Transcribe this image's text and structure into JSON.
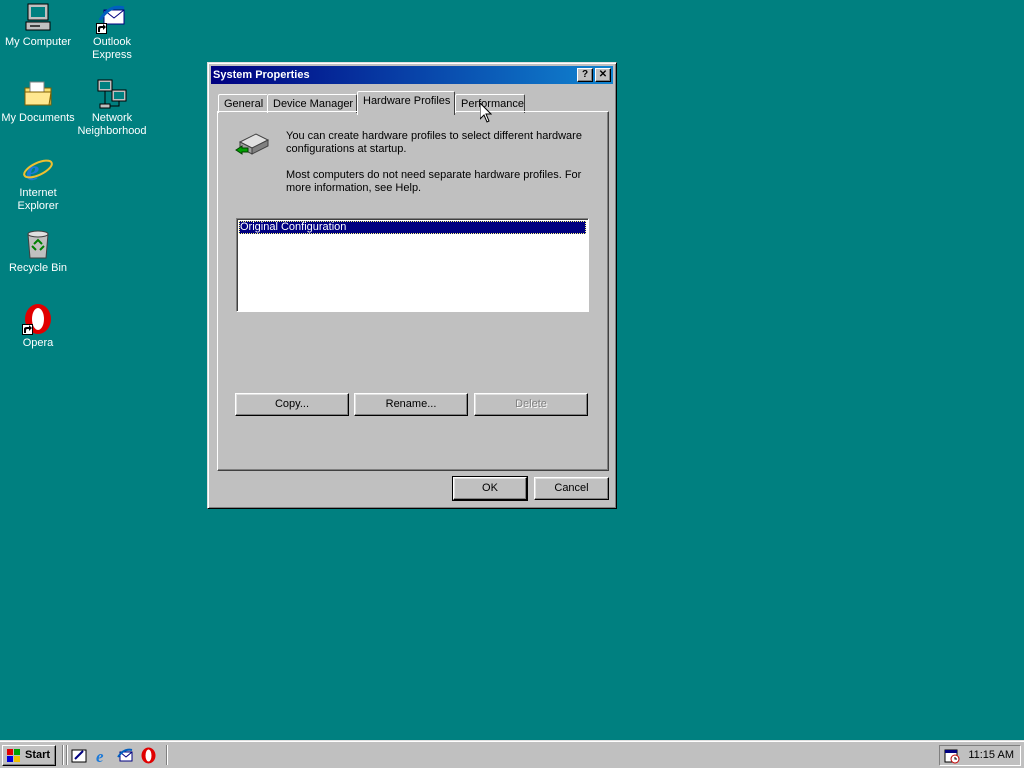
{
  "desktop": {
    "icons": [
      {
        "label": "My Computer",
        "icon": "my-computer-icon"
      },
      {
        "label": "Outlook Express",
        "icon": "outlook-express-icon"
      },
      {
        "label": "My Documents",
        "icon": "my-documents-icon"
      },
      {
        "label": "Network Neighborhood",
        "icon": "network-neighborhood-icon"
      },
      {
        "label": "Internet Explorer",
        "icon": "internet-explorer-icon"
      },
      {
        "label": "Recycle Bin",
        "icon": "recycle-bin-icon"
      },
      {
        "label": "Opera",
        "icon": "opera-icon"
      }
    ],
    "background_color": "#008080"
  },
  "window": {
    "title": "System Properties",
    "help_glyph": "?",
    "close_glyph": "✕",
    "tabs": [
      {
        "label": "General"
      },
      {
        "label": "Device Manager"
      },
      {
        "label": "Hardware Profiles"
      },
      {
        "label": "Performance"
      }
    ],
    "active_tab": "Hardware Profiles",
    "description_1": "You can create hardware profiles to select different hardware configurations at startup.",
    "description_2": "Most computers do not need separate hardware profiles. For more information, see Help.",
    "profiles": [
      {
        "label": "Original Configuration",
        "selected": true
      }
    ],
    "buttons": {
      "copy": "Copy...",
      "rename": "Rename...",
      "delete": "Delete",
      "ok": "OK",
      "cancel": "Cancel"
    }
  },
  "taskbar": {
    "start_label": "Start",
    "quick_launch": [
      "show-desktop-icon",
      "internet-explorer-icon",
      "outlook-express-icon",
      "opera-icon"
    ],
    "clock": "11:15 AM"
  }
}
